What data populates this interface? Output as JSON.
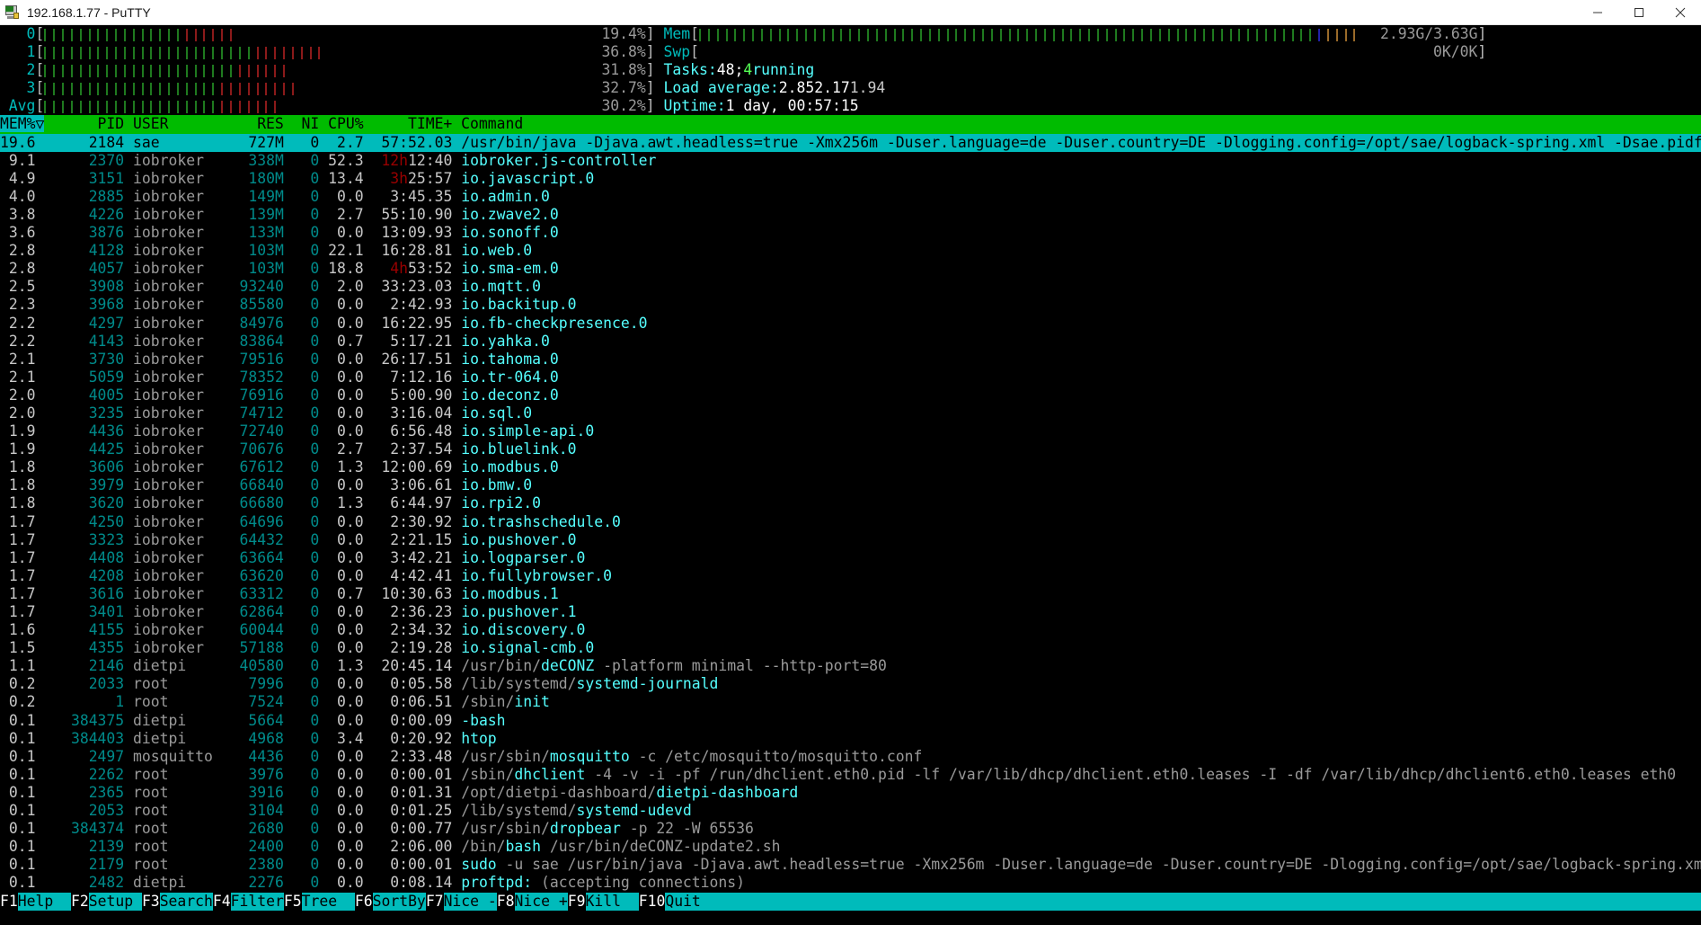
{
  "window": {
    "title": "192.168.1.77 - PuTTY",
    "icon": "putty-icon",
    "minimize_label": "–",
    "maximize_label": "□",
    "close_label": "✕"
  },
  "cpu_meters": [
    {
      "label": "0",
      "pct": "19.4%",
      "green_cells": 16,
      "red_cells": 6,
      "total_cells": 68
    },
    {
      "label": "1",
      "pct": "36.8%",
      "green_cells": 24,
      "red_cells": 8,
      "total_cells": 68
    },
    {
      "label": "2",
      "pct": "31.8%",
      "green_cells": 22,
      "red_cells": 6,
      "total_cells": 68
    },
    {
      "label": "3",
      "pct": "32.7%",
      "green_cells": 20,
      "red_cells": 9,
      "total_cells": 68
    },
    {
      "label": "Avg",
      "pct": "30.2%",
      "green_cells": 20,
      "red_cells": 7,
      "total_cells": 68
    }
  ],
  "mem_meter": {
    "label": "Mem",
    "value": "2.93G/3.63G",
    "green_cells": 70,
    "blue_cells": 1,
    "orange_cells": 4,
    "total_cells": 88
  },
  "swap_meter": {
    "label": "Swp",
    "value": "0K/0K",
    "used_cells": 0,
    "total_cells": 88
  },
  "summary": {
    "tasks_label": "Tasks:",
    "tasks_count": "48;",
    "running_count": "4",
    "running_label": "running",
    "load_label": "Load average:",
    "load_1": "2.85",
    "load_5": "2.17",
    "load_15": "1.94",
    "uptime_label": "Uptime:",
    "uptime_value": "1 day, 00:57:15"
  },
  "table": {
    "columns": [
      {
        "key": "mem",
        "label": "MEM%▽",
        "sorted": true
      },
      {
        "key": "pid",
        "label": "PID"
      },
      {
        "key": "user",
        "label": "USER"
      },
      {
        "key": "res",
        "label": "RES"
      },
      {
        "key": "ni",
        "label": "NI"
      },
      {
        "key": "cpu",
        "label": "CPU%"
      },
      {
        "key": "time",
        "label": "TIME+"
      },
      {
        "key": "command",
        "label": "Command"
      }
    ],
    "rows": [
      {
        "mem": "19.6",
        "pid": "2184",
        "user": "sae",
        "res": "727M",
        "ni": "0",
        "cpu": "2.7",
        "time": "57:52.03",
        "cmd_dir": "/usr/bin/",
        "cmd_base": "java",
        "cmd_args": " -Djava.awt.headless=true -Xmx256m -Duser.language=de -Duser.country=DE -Dlogging.config=/opt/sae/logback-spring.xml -Dsae.pidfil",
        "selected": true
      },
      {
        "mem": "9.1",
        "pid": "2370",
        "user": "iobroker",
        "res": "338M",
        "ni": "0",
        "cpu": "52.3",
        "time_hours": "12h",
        "time": "12:40",
        "cmd_dir": "",
        "cmd_base": "iobroker.js-controller",
        "cmd_args": ""
      },
      {
        "mem": "4.9",
        "pid": "3151",
        "user": "iobroker",
        "res": "180M",
        "ni": "0",
        "cpu": "13.4",
        "time_hours": "3h",
        "time": "25:57",
        "cmd_dir": "",
        "cmd_base": "io.javascript.0",
        "cmd_args": ""
      },
      {
        "mem": "4.0",
        "pid": "2885",
        "user": "iobroker",
        "res": "149M",
        "ni": "0",
        "cpu": "0.0",
        "time": "3:45.35",
        "cmd_dir": "",
        "cmd_base": "io.admin.0",
        "cmd_args": ""
      },
      {
        "mem": "3.8",
        "pid": "4226",
        "user": "iobroker",
        "res": "139M",
        "ni": "0",
        "cpu": "2.7",
        "time": "55:10.90",
        "cmd_dir": "",
        "cmd_base": "io.zwave2.0",
        "cmd_args": ""
      },
      {
        "mem": "3.6",
        "pid": "3876",
        "user": "iobroker",
        "res": "133M",
        "ni": "0",
        "cpu": "0.0",
        "time": "13:09.93",
        "cmd_dir": "",
        "cmd_base": "io.sonoff.0",
        "cmd_args": ""
      },
      {
        "mem": "2.8",
        "pid": "4128",
        "user": "iobroker",
        "res": "103M",
        "ni": "0",
        "cpu": "22.1",
        "time": "16:28.81",
        "cmd_dir": "",
        "cmd_base": "io.web.0",
        "cmd_args": ""
      },
      {
        "mem": "2.8",
        "pid": "4057",
        "user": "iobroker",
        "res": "103M",
        "ni": "0",
        "cpu": "18.8",
        "time_hours": "4h",
        "time": "53:52",
        "cmd_dir": "",
        "cmd_base": "io.sma-em.0",
        "cmd_args": ""
      },
      {
        "mem": "2.5",
        "pid": "3908",
        "user": "iobroker",
        "res": "93240",
        "ni": "0",
        "cpu": "2.0",
        "time": "33:23.03",
        "cmd_dir": "",
        "cmd_base": "io.mqtt.0",
        "cmd_args": ""
      },
      {
        "mem": "2.3",
        "pid": "3968",
        "user": "iobroker",
        "res": "85580",
        "ni": "0",
        "cpu": "0.0",
        "time": "2:42.93",
        "cmd_dir": "",
        "cmd_base": "io.backitup.0",
        "cmd_args": ""
      },
      {
        "mem": "2.2",
        "pid": "4297",
        "user": "iobroker",
        "res": "84976",
        "ni": "0",
        "cpu": "0.0",
        "time": "16:22.95",
        "cmd_dir": "",
        "cmd_base": "io.fb-checkpresence.0",
        "cmd_args": ""
      },
      {
        "mem": "2.2",
        "pid": "4143",
        "user": "iobroker",
        "res": "83864",
        "ni": "0",
        "cpu": "0.7",
        "time": "5:17.21",
        "cmd_dir": "",
        "cmd_base": "io.yahka.0",
        "cmd_args": ""
      },
      {
        "mem": "2.1",
        "pid": "3730",
        "user": "iobroker",
        "res": "79516",
        "ni": "0",
        "cpu": "0.0",
        "time": "26:17.51",
        "cmd_dir": "",
        "cmd_base": "io.tahoma.0",
        "cmd_args": ""
      },
      {
        "mem": "2.1",
        "pid": "5059",
        "user": "iobroker",
        "res": "78352",
        "ni": "0",
        "cpu": "0.0",
        "time": "7:12.16",
        "cmd_dir": "",
        "cmd_base": "io.tr-064.0",
        "cmd_args": ""
      },
      {
        "mem": "2.0",
        "pid": "4005",
        "user": "iobroker",
        "res": "76916",
        "ni": "0",
        "cpu": "0.0",
        "time": "5:00.90",
        "cmd_dir": "",
        "cmd_base": "io.deconz.0",
        "cmd_args": ""
      },
      {
        "mem": "2.0",
        "pid": "3235",
        "user": "iobroker",
        "res": "74712",
        "ni": "0",
        "cpu": "0.0",
        "time": "3:16.04",
        "cmd_dir": "",
        "cmd_base": "io.sql.0",
        "cmd_args": ""
      },
      {
        "mem": "1.9",
        "pid": "4436",
        "user": "iobroker",
        "res": "72740",
        "ni": "0",
        "cpu": "0.0",
        "time": "6:56.48",
        "cmd_dir": "",
        "cmd_base": "io.simple-api.0",
        "cmd_args": ""
      },
      {
        "mem": "1.9",
        "pid": "4425",
        "user": "iobroker",
        "res": "70676",
        "ni": "0",
        "cpu": "2.7",
        "time": "2:37.54",
        "cmd_dir": "",
        "cmd_base": "io.bluelink.0",
        "cmd_args": ""
      },
      {
        "mem": "1.8",
        "pid": "3606",
        "user": "iobroker",
        "res": "67612",
        "ni": "0",
        "cpu": "1.3",
        "time": "12:00.69",
        "cmd_dir": "",
        "cmd_base": "io.modbus.0",
        "cmd_args": ""
      },
      {
        "mem": "1.8",
        "pid": "3979",
        "user": "iobroker",
        "res": "66840",
        "ni": "0",
        "cpu": "0.0",
        "time": "3:06.61",
        "cmd_dir": "",
        "cmd_base": "io.bmw.0",
        "cmd_args": ""
      },
      {
        "mem": "1.8",
        "pid": "3620",
        "user": "iobroker",
        "res": "66680",
        "ni": "0",
        "cpu": "1.3",
        "time": "6:44.97",
        "cmd_dir": "",
        "cmd_base": "io.rpi2.0",
        "cmd_args": ""
      },
      {
        "mem": "1.7",
        "pid": "4250",
        "user": "iobroker",
        "res": "64696",
        "ni": "0",
        "cpu": "0.0",
        "time": "2:30.92",
        "cmd_dir": "",
        "cmd_base": "io.trashschedule.0",
        "cmd_args": ""
      },
      {
        "mem": "1.7",
        "pid": "3323",
        "user": "iobroker",
        "res": "64432",
        "ni": "0",
        "cpu": "0.0",
        "time": "2:21.15",
        "cmd_dir": "",
        "cmd_base": "io.pushover.0",
        "cmd_args": ""
      },
      {
        "mem": "1.7",
        "pid": "4408",
        "user": "iobroker",
        "res": "63664",
        "ni": "0",
        "cpu": "0.0",
        "time": "3:42.21",
        "cmd_dir": "",
        "cmd_base": "io.logparser.0",
        "cmd_args": ""
      },
      {
        "mem": "1.7",
        "pid": "4208",
        "user": "iobroker",
        "res": "63620",
        "ni": "0",
        "cpu": "0.0",
        "time": "4:42.41",
        "cmd_dir": "",
        "cmd_base": "io.fullybrowser.0",
        "cmd_args": ""
      },
      {
        "mem": "1.7",
        "pid": "3616",
        "user": "iobroker",
        "res": "63312",
        "ni": "0",
        "cpu": "0.7",
        "time": "10:30.63",
        "cmd_dir": "",
        "cmd_base": "io.modbus.1",
        "cmd_args": ""
      },
      {
        "mem": "1.7",
        "pid": "3401",
        "user": "iobroker",
        "res": "62864",
        "ni": "0",
        "cpu": "0.0",
        "time": "2:36.23",
        "cmd_dir": "",
        "cmd_base": "io.pushover.1",
        "cmd_args": ""
      },
      {
        "mem": "1.6",
        "pid": "4155",
        "user": "iobroker",
        "res": "60044",
        "ni": "0",
        "cpu": "0.0",
        "time": "2:34.32",
        "cmd_dir": "",
        "cmd_base": "io.discovery.0",
        "cmd_args": ""
      },
      {
        "mem": "1.5",
        "pid": "4355",
        "user": "iobroker",
        "res": "57188",
        "ni": "0",
        "cpu": "0.0",
        "time": "2:19.28",
        "cmd_dir": "",
        "cmd_base": "io.signal-cmb.0",
        "cmd_args": ""
      },
      {
        "mem": "1.1",
        "pid": "2146",
        "user": "dietpi",
        "res": "40580",
        "ni": "0",
        "cpu": "1.3",
        "time": "20:45.14",
        "cmd_dir": "/usr/bin/",
        "cmd_base": "deCONZ",
        "cmd_args": " -platform minimal --http-port=80"
      },
      {
        "mem": "0.2",
        "pid": "2033",
        "user": "root",
        "res": "7996",
        "ni": "0",
        "cpu": "0.0",
        "time": "0:05.58",
        "cmd_dir": "/lib/systemd/",
        "cmd_base": "systemd-journald",
        "cmd_args": ""
      },
      {
        "mem": "0.2",
        "pid": "1",
        "user": "root",
        "res": "7524",
        "ni": "0",
        "cpu": "0.0",
        "time": "0:06.51",
        "cmd_dir": "/sbin/",
        "cmd_base": "init",
        "cmd_args": ""
      },
      {
        "mem": "0.1",
        "pid": "384375",
        "user": "dietpi",
        "res": "5664",
        "ni": "0",
        "cpu": "0.0",
        "time": "0:00.09",
        "cmd_dir": "",
        "cmd_base": "-bash",
        "cmd_args": ""
      },
      {
        "mem": "0.1",
        "pid": "384403",
        "user": "dietpi",
        "res": "4968",
        "ni": "0",
        "cpu": "3.4",
        "time": "0:20.92",
        "cmd_dir": "",
        "cmd_base": "htop",
        "cmd_args": ""
      },
      {
        "mem": "0.1",
        "pid": "2497",
        "user": "mosquitto",
        "res": "4436",
        "ni": "0",
        "cpu": "0.0",
        "time": "2:33.48",
        "cmd_dir": "/usr/sbin/",
        "cmd_base": "mosquitto",
        "cmd_args": " -c /etc/mosquitto/mosquitto.conf"
      },
      {
        "mem": "0.1",
        "pid": "2262",
        "user": "root",
        "res": "3976",
        "ni": "0",
        "cpu": "0.0",
        "time": "0:00.01",
        "cmd_dir": "/sbin/",
        "cmd_base": "dhclient",
        "cmd_args": " -4 -v -i -pf /run/dhclient.eth0.pid -lf /var/lib/dhcp/dhclient.eth0.leases -I -df /var/lib/dhcp/dhclient6.eth0.leases eth0"
      },
      {
        "mem": "0.1",
        "pid": "2365",
        "user": "root",
        "res": "3916",
        "ni": "0",
        "cpu": "0.0",
        "time": "0:01.31",
        "cmd_dir": "/opt/dietpi-dashboard/",
        "cmd_base": "dietpi-dashboard",
        "cmd_args": ""
      },
      {
        "mem": "0.1",
        "pid": "2053",
        "user": "root",
        "res": "3104",
        "ni": "0",
        "cpu": "0.0",
        "time": "0:01.25",
        "cmd_dir": "/lib/systemd/",
        "cmd_base": "systemd-udevd",
        "cmd_args": ""
      },
      {
        "mem": "0.1",
        "pid": "384374",
        "user": "root",
        "res": "2680",
        "ni": "0",
        "cpu": "0.0",
        "time": "0:00.77",
        "cmd_dir": "/usr/sbin/",
        "cmd_base": "dropbear",
        "cmd_args": " -p 22 -W 65536"
      },
      {
        "mem": "0.1",
        "pid": "2139",
        "user": "root",
        "res": "2400",
        "ni": "0",
        "cpu": "0.0",
        "time": "2:06.00",
        "cmd_dir": "/bin/",
        "cmd_base": "bash",
        "cmd_args": " /usr/bin/deCONZ-update2.sh"
      },
      {
        "mem": "0.1",
        "pid": "2179",
        "user": "root",
        "res": "2380",
        "ni": "0",
        "cpu": "0.0",
        "time": "0:00.01",
        "cmd_dir": "",
        "cmd_base": "sudo",
        "cmd_args": " -u sae /usr/bin/java -Djava.awt.headless=true -Xmx256m -Duser.language=de -Duser.country=DE -Dlogging.config=/opt/sae/logback-spring.xml"
      },
      {
        "mem": "0.1",
        "pid": "2482",
        "user": "dietpi",
        "res": "2276",
        "ni": "0",
        "cpu": "0.0",
        "time": "0:08.14",
        "cmd_dir": "",
        "cmd_base": "proftpd:",
        "cmd_args": " (accepting connections)"
      }
    ]
  },
  "function_bar": [
    {
      "key": "F1",
      "label": "Help  "
    },
    {
      "key": "F2",
      "label": "Setup "
    },
    {
      "key": "F3",
      "label": "Search"
    },
    {
      "key": "F4",
      "label": "Filter"
    },
    {
      "key": "F5",
      "label": "Tree  "
    },
    {
      "key": "F6",
      "label": "SortBy"
    },
    {
      "key": "F7",
      "label": "Nice -"
    },
    {
      "key": "F8",
      "label": "Nice +"
    },
    {
      "key": "F9",
      "label": "Kill  "
    },
    {
      "key": "F10",
      "label": "Quit  "
    }
  ],
  "colors": {
    "accent_green": "#00bb00",
    "accent_cyan": "#00bbbb",
    "bar_green": "#1f7a1f",
    "bar_red": "#8b1a1a",
    "bar_blue": "#2222aa",
    "bar_orange": "#9a6b2a",
    "background": "#000000"
  }
}
